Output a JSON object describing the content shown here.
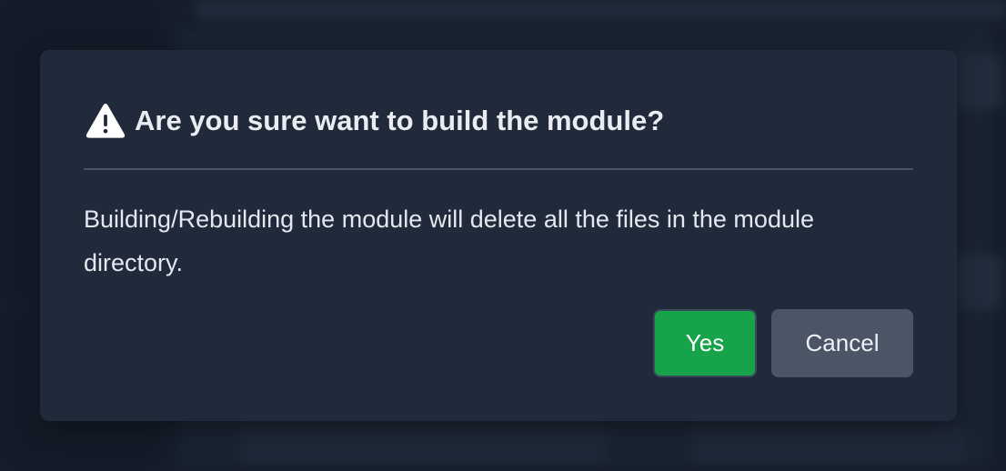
{
  "dialog": {
    "icon": "warning-triangle-icon",
    "title": "Are you sure want to build the module?",
    "message": "Building/Rebuilding the module will delete all the files in the module directory.",
    "buttons": {
      "yes_label": "Yes",
      "cancel_label": "Cancel"
    }
  },
  "colors": {
    "modal_background": "#212a3a",
    "yes_button": "#17a34a",
    "cancel_button": "#4b5566",
    "title_text": "#e9ecf1"
  }
}
